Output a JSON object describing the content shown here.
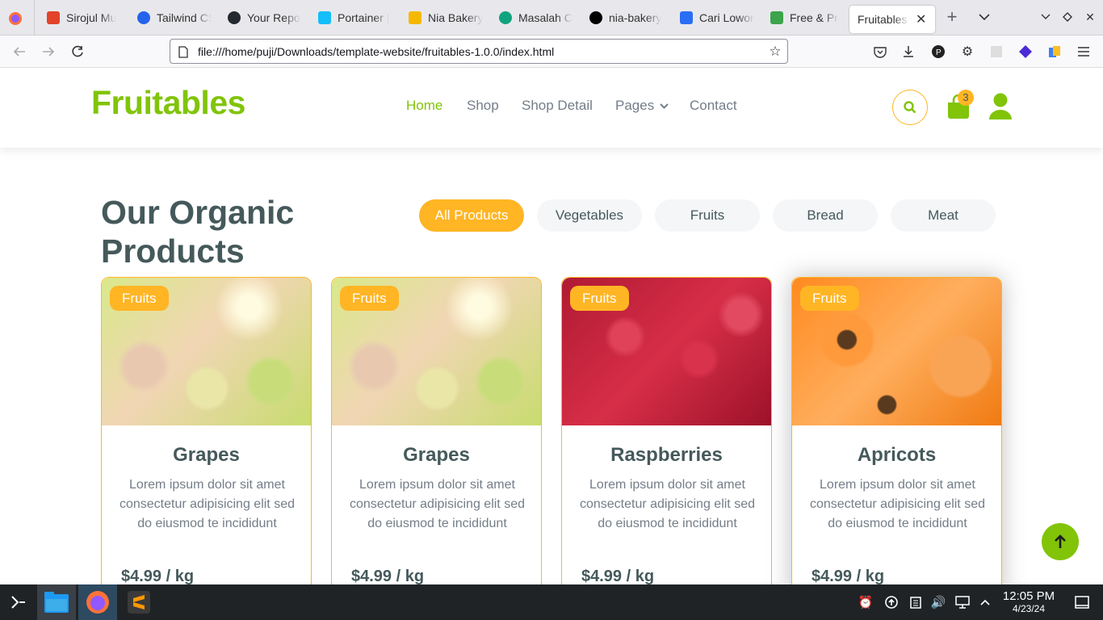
{
  "browser": {
    "tabs": [
      {
        "label": "Sirojul Mu",
        "color": "#e24329"
      },
      {
        "label": "Tailwind CS",
        "color": "#2563eb"
      },
      {
        "label": "Your Repo",
        "color": "#24292f"
      },
      {
        "label": "Portainer |",
        "color": "#13bef9"
      },
      {
        "label": "Nia Bakery",
        "color": "#f5b800"
      },
      {
        "label": "Masalah C",
        "color": "#10a37f"
      },
      {
        "label": "nia-bakery",
        "color": "#000000"
      },
      {
        "label": "Cari Lowon",
        "color": "#2a6ef5"
      },
      {
        "label": "Free & Pre",
        "color": "#3ca44a"
      },
      {
        "label": "Fruitables - ",
        "color": "#ffffff"
      }
    ],
    "url": "file:///home/puji/Downloads/template-website/fruitables-1.0.0/index.html"
  },
  "site": {
    "logo": "Fruitables",
    "nav": [
      "Home",
      "Shop",
      "Shop Detail",
      "Pages",
      "Contact"
    ],
    "cart_count": "3",
    "colors": {
      "primary": "#81c408",
      "secondary": "#ffb524",
      "text": "#45595b"
    }
  },
  "section": {
    "title_line1": "Our Organic",
    "title_line2": "Products",
    "filters": [
      "All Products",
      "Vegetables",
      "Fruits",
      "Bread",
      "Meat"
    ]
  },
  "products": [
    {
      "category": "Fruits",
      "name": "Grapes",
      "desc": "Lorem ipsum dolor sit amet consectetur adipisicing elit sed do eiusmod te incididunt",
      "price": "$4.99 / kg"
    },
    {
      "category": "Fruits",
      "name": "Grapes",
      "desc": "Lorem ipsum dolor sit amet consectetur adipisicing elit sed do eiusmod te incididunt",
      "price": "$4.99 / kg"
    },
    {
      "category": "Fruits",
      "name": "Raspberries",
      "desc": "Lorem ipsum dolor sit amet consectetur adipisicing elit sed do eiusmod te incididunt",
      "price": "$4.99 / kg"
    },
    {
      "category": "Fruits",
      "name": "Apricots",
      "desc": "Lorem ipsum dolor sit amet consectetur adipisicing elit sed do eiusmod te incididunt",
      "price": "$4.99 / kg"
    }
  ],
  "taskbar": {
    "time": "12:05 PM",
    "date": "4/23/24"
  }
}
